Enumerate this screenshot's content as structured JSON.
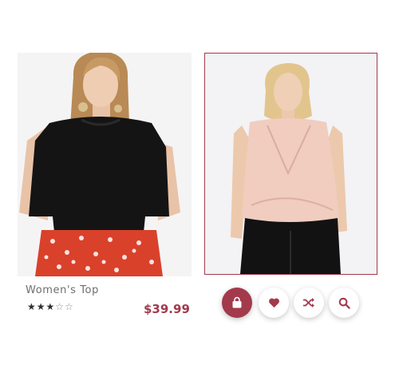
{
  "product": {
    "title": "Women's Top",
    "price": "$39.99",
    "rating": 3,
    "rating_max": 5,
    "stars_filled": "★★★",
    "stars_empty": "☆☆"
  },
  "images": [
    {
      "icon": "product-image-black-top"
    },
    {
      "icon": "product-image-blush-wrap-top"
    }
  ],
  "actions": [
    {
      "icon": "shopping-bag-icon"
    },
    {
      "icon": "heart-icon"
    },
    {
      "icon": "shuffle-icon"
    },
    {
      "icon": "search-icon"
    }
  ],
  "colors": {
    "accent": "#a23a4c",
    "title_text": "#6e6e6e",
    "stars": "#2f2f2f"
  }
}
